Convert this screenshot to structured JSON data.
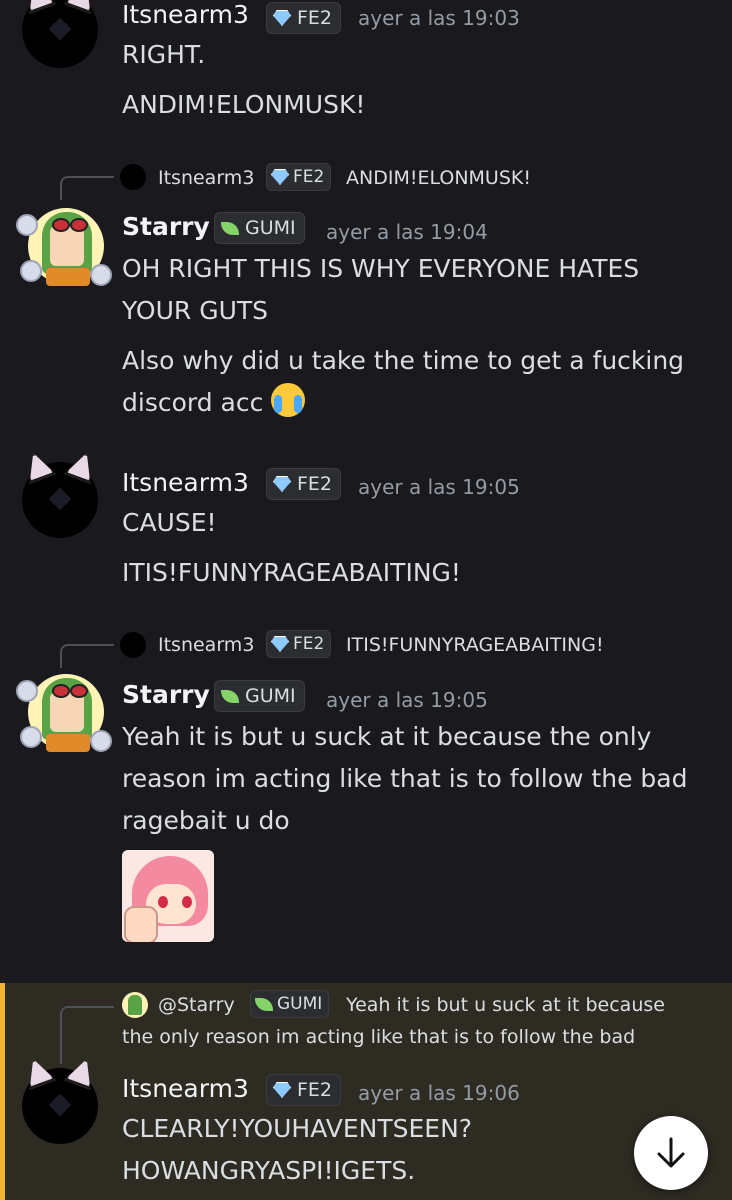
{
  "users": {
    "its": {
      "name": "Itsnearm3",
      "badge": "FE2"
    },
    "starry": {
      "name": "Starry",
      "badge": "GUMI"
    }
  },
  "messages": [
    {
      "time": "ayer a las 19:03",
      "lines": [
        "RIGHT.",
        "ANDIM!ELONMUSK!"
      ]
    },
    {
      "reply_to": {
        "name": "Itsnearm3",
        "badge": "FE2",
        "text": "ANDIM!ELONMUSK!"
      },
      "time": "ayer a las 19:04",
      "lines": [
        "OH RIGHT THIS IS WHY EVERYONE HATES",
        "YOUR GUTS",
        "Also why did u take the time to get a fucking",
        "discord acc"
      ],
      "emoji": "loudly-crying-face"
    },
    {
      "time": "ayer a las 19:05",
      "lines": [
        "CAUSE!",
        "ITIS!FUNNYRAGEABAITING!"
      ]
    },
    {
      "reply_to": {
        "name": "Itsnearm3",
        "badge": "FE2",
        "text": "ITIS!FUNNYRAGEABAITING!"
      },
      "time": "ayer a las 19:05",
      "lines": [
        "Yeah it is but u suck at it because the only",
        "reason im acting like that is to follow the bad",
        "ragebait u do"
      ],
      "sticker": "pink-hair-anime-thumbs-up"
    },
    {
      "reply_to": {
        "name": "@Starry",
        "badge": "GUMI",
        "text_line1": "Yeah it is but u suck at it because",
        "text_line2": "the only reason im acting like that is to follow the bad"
      },
      "time": "ayer a las 19:06",
      "lines": [
        "CLEARLY!YOUHAVENTSEEN?",
        "HOWANGRYASPI!IGETS."
      ]
    }
  ],
  "icons": {
    "badge_fe2": "diamond-icon",
    "badge_gumi": "leaf-icon",
    "scroll": "arrow-down-icon"
  },
  "colors": {
    "background": "#1a1a1e",
    "highlight": "#2e2b22",
    "highlight_bar": "#f0b232"
  }
}
